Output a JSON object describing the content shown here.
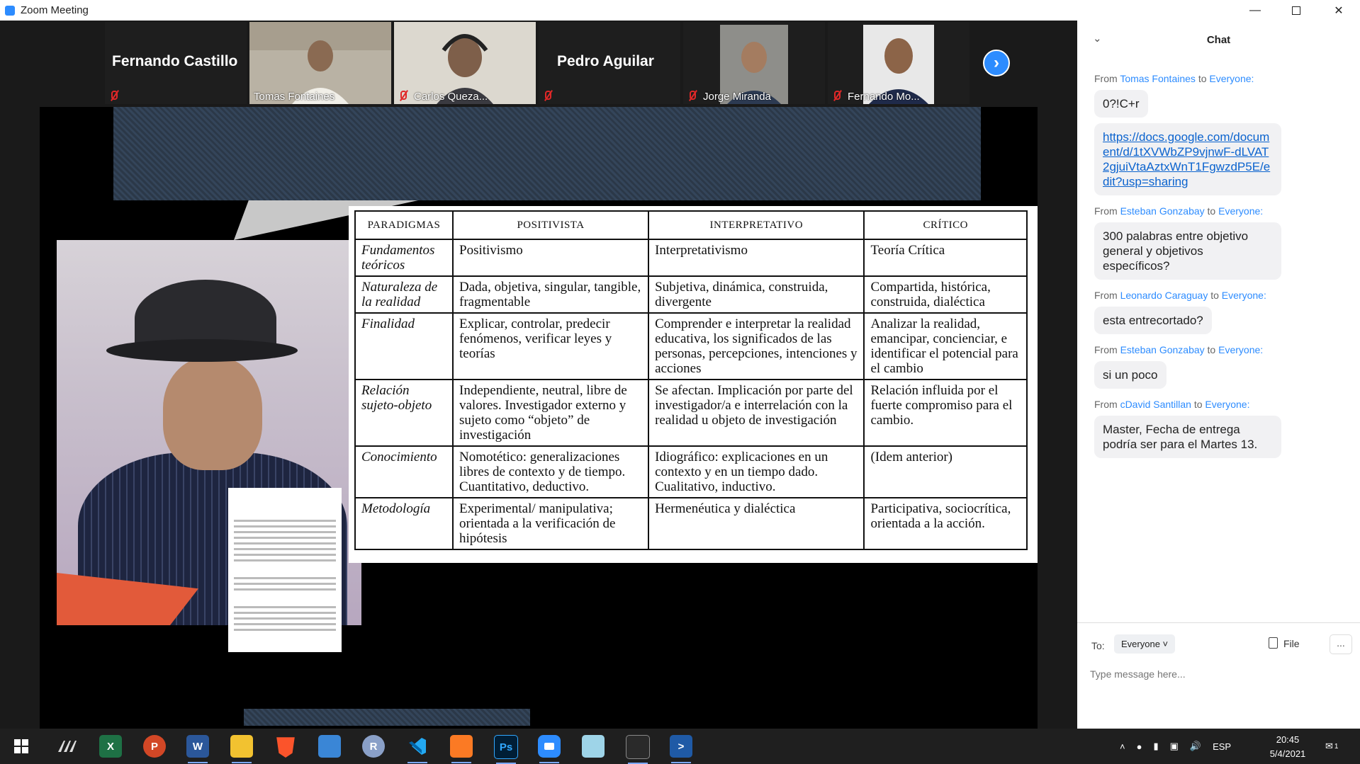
{
  "window": {
    "title": "Zoom Meeting"
  },
  "participants": [
    {
      "name": "Fernando Castillo",
      "display": "name-only",
      "muted": true
    },
    {
      "name": "Tomas Fontaines",
      "display": "video",
      "muted": false,
      "active": true
    },
    {
      "name": "Carlos Queza...",
      "display": "video",
      "muted": true
    },
    {
      "name": "Pedro Aguilar",
      "display": "name-only",
      "muted": true
    },
    {
      "name": "Jorge Miranda",
      "display": "video",
      "muted": true
    },
    {
      "name": "Fernando Mo...",
      "display": "video",
      "muted": true
    }
  ],
  "shared_table": {
    "headers": [
      "PARADIGMAS",
      "POSITIVISTA",
      "INTERPRETATIVO",
      "CRÍTICO"
    ],
    "rows": [
      {
        "label": "Fundamentos teóricos",
        "c1": "Positivismo",
        "c2": "Interpretativismo",
        "c3": "Teoría Crítica"
      },
      {
        "label": "Naturaleza de la realidad",
        "c1": "Dada, objetiva, singular, tangible, fragmentable",
        "c2": "Subjetiva, dinámica, construida, divergente",
        "c3": "Compartida, histórica, construida, dialéctica"
      },
      {
        "label": "Finalidad",
        "c1": "Explicar, controlar, predecir fenómenos, verificar leyes y teorías",
        "c2": "Comprender e interpretar la realidad educativa, los significados de las personas, percepciones, intenciones y acciones",
        "c3": "Analizar la realidad, emancipar, concienciar, e identificar el potencial para el cambio"
      },
      {
        "label": "Relación sujeto-objeto",
        "c1": "Independiente, neutral, libre de valores. Investigador externo y sujeto como “objeto” de investigación",
        "c2": "Se afectan. Implicación por parte del investigador/a e interrelación con la realidad u objeto de investigación",
        "c3": "Relación influida por el fuerte compromiso para el cambio."
      },
      {
        "label": "Conocimiento",
        "c1": "Nomotético: generalizaciones libres de contexto y de tiempo. Cuantitativo, deductivo.",
        "c2": "Idiográfico: explicaciones en un contexto y en un tiempo dado. Cualitativo, inductivo.",
        "c3": "(Idem anterior)"
      },
      {
        "label": "Metodología",
        "c1": "Experimental/ manipulativa; orientada a la verificación de hipótesis",
        "c2": "Hermenéutica y dialéctica",
        "c3": "Participativa, sociocrítica, orientada a la acción."
      }
    ]
  },
  "chat": {
    "title": "Chat",
    "to_word": "to",
    "from_word": "From",
    "messages": [
      {
        "from": "Tomas Fontaines",
        "to": "Everyone:",
        "text": "0?!C+r",
        "link": false
      },
      {
        "from": "",
        "to": "",
        "text": "https://docs.google.com/document/d/1tXVWbZP9vjnwF-dLVAT2gjuiVtaAztxWnT1FgwzdP5E/edit?usp=sharing",
        "link": true
      },
      {
        "from": "Esteban Gonzabay",
        "to": "Everyone:",
        "text": "300 palabras entre objetivo general y objetivos específicos?",
        "link": false
      },
      {
        "from": "Leonardo Caraguay",
        "to": "Everyone:",
        "text": "esta entrecortado?",
        "link": false
      },
      {
        "from": "Esteban Gonzabay",
        "to": "Everyone:",
        "text": "si un poco",
        "link": false
      },
      {
        "from": "cDavid Santillan",
        "to": "Everyone:",
        "text": "Master, Fecha de entrega podría ser para el Martes 13.",
        "link": false
      }
    ],
    "compose": {
      "to_label": "To:",
      "recipient": "Everyone",
      "file_label": "File",
      "more_label": "...",
      "placeholder": "Type message here..."
    }
  },
  "taskbar": {
    "apps": [
      "start",
      "app-m",
      "excel",
      "powerpoint",
      "word",
      "file-explorer",
      "brave",
      "control-panel",
      "r",
      "vscode",
      "xampp",
      "photoshop",
      "zoom",
      "notepad",
      "terminal",
      "powershell"
    ],
    "language": "ESP",
    "time": "20:45",
    "date": "5/4/2021",
    "notifications": "1"
  }
}
